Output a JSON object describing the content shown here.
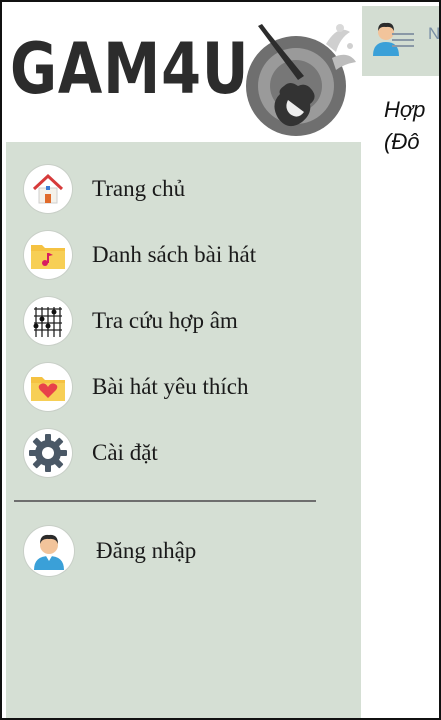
{
  "app": {
    "logo_text": "GAM4U"
  },
  "topbar": {
    "partial_letter": "N"
  },
  "content": {
    "title_line1": "Hợp",
    "title_line2": "(Đô"
  },
  "drawer": {
    "items": [
      {
        "label": "Trang chủ",
        "icon": "home-icon"
      },
      {
        "label": "Danh sách bài hát",
        "icon": "music-folder-icon"
      },
      {
        "label": "Tra cứu hợp âm",
        "icon": "chord-chart-icon"
      },
      {
        "label": "Bài hát yêu thích",
        "icon": "favorite-folder-icon"
      },
      {
        "label": "Cài đặt",
        "icon": "gear-icon"
      }
    ],
    "login": {
      "label": "Đăng nhập",
      "icon": "user-avatar-icon"
    }
  },
  "colors": {
    "drawer_bg": "#d5dfd4",
    "folder": "#f5c242",
    "heart": "#e8424a",
    "gear": "#4a5866"
  }
}
